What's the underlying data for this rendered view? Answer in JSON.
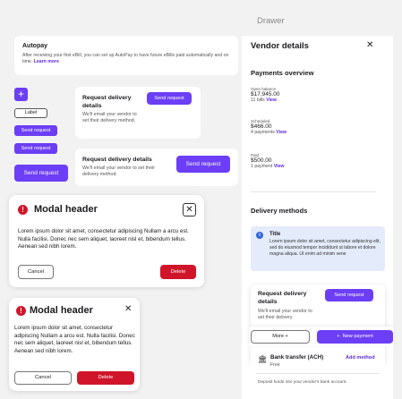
{
  "drawer_label": "Drawer",
  "autopay": {
    "title": "Autopay",
    "body": "After receiving your first eBill, you can set up AutoPay to have future eBills paid automatically and on time.",
    "link": "Learn more"
  },
  "left_stack": {
    "plus": "+",
    "label_chip": "Label",
    "send_request": "Send request"
  },
  "request_card": {
    "title": "Request delivery details",
    "subtitle": "We'll email your vendor to set their delivery method.",
    "button": "Send request"
  },
  "modal": {
    "title": "Modal header",
    "body": "Lorem ipsum dolor sit amet, consectetur adipiscing Nullam a arcu est. Nulla facilisi. Donec nec sem aliquet, laoreet nisl et, bibendum tellus. Aenean sed nibh lorem.",
    "cancel": "Cancel",
    "delete": "Delete"
  },
  "drawer": {
    "title": "Vendor details",
    "payments_overview": "Payments overview",
    "open_balance": {
      "label": "Open balance",
      "amount": "$17,945.00",
      "count": "11 bills",
      "link": "View"
    },
    "scheduled": {
      "label": "Scheduled",
      "amount": "$466.00",
      "count": "4 payments",
      "link": "View"
    },
    "paid": {
      "label": "Paid",
      "amount": "$500.00",
      "count": "1 payment",
      "link": "View"
    },
    "delivery_methods": "Delivery methods",
    "alert": {
      "title": "Title",
      "body": "Lorem ipsum dolor sit amet, consectetur adipiscing elit, sed do eiusmod tempor incididunt ut labore et dolore magna aliqua. Ut enim ad minim vene"
    },
    "request": {
      "title": "Request delivery details",
      "subtitle": "We'll email your vendor to set their delivery",
      "button": "Send request"
    },
    "more": "More",
    "new_payment": "New payment",
    "bank": {
      "title": "Bank transfer (ACH)",
      "fee": "Free",
      "add": "Add method",
      "note": "Deposit funds into your vendor's bank account."
    }
  },
  "colors": {
    "primary": "#6c3ef5",
    "danger": "#d0152a",
    "info_bg": "#e4ebfb"
  }
}
